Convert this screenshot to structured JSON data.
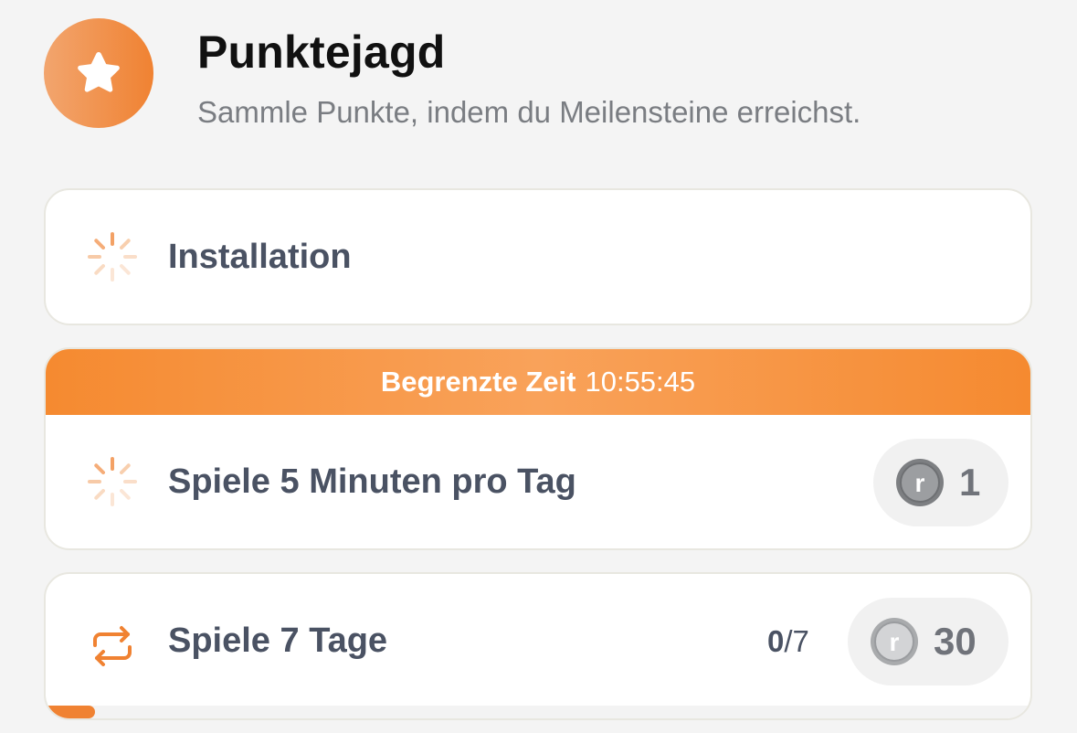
{
  "header": {
    "icon": "star-icon",
    "title": "Punktejagd",
    "subtitle": "Sammle Punkte, indem du Meilensteine erreichst."
  },
  "colors": {
    "accent": "#f08232",
    "text_dark": "#4a5263",
    "muted": "#7a7d82"
  },
  "tasks": [
    {
      "icon": "loading-spinner-icon",
      "label": "Installation"
    },
    {
      "banner_label": "Begrenzte Zeit",
      "banner_time": "10:55:45",
      "icon": "loading-spinner-icon",
      "label": "Spiele 5 Minuten pro Tag",
      "reward_icon": "coin-icon",
      "reward": "1"
    },
    {
      "icon": "repeat-icon",
      "label": "Spiele 7 Tage",
      "progress_done": "0",
      "progress_total": "/7",
      "progress_fraction": 0.05,
      "reward_icon": "coin-icon",
      "reward": "30"
    }
  ]
}
